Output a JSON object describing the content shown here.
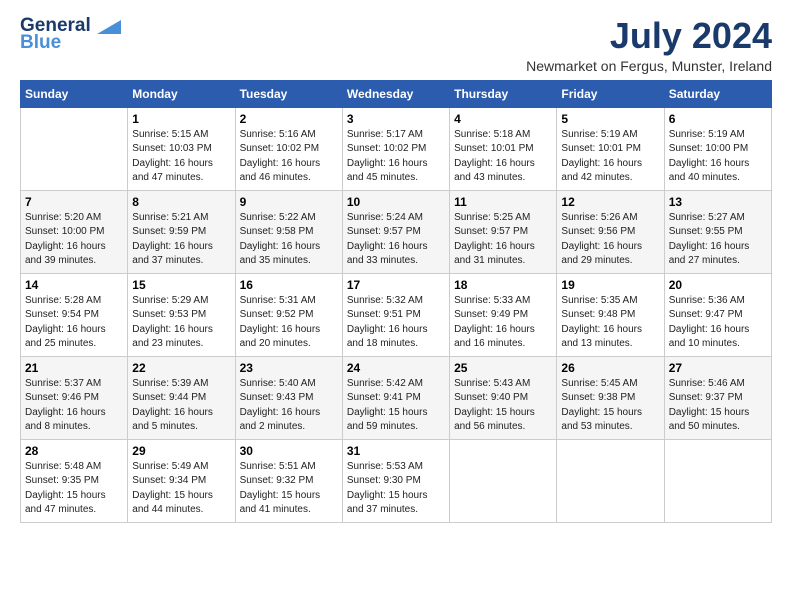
{
  "header": {
    "logo_line1": "General",
    "logo_line2": "Blue",
    "month_title": "July 2024",
    "subtitle": "Newmarket on Fergus, Munster, Ireland"
  },
  "weekdays": [
    "Sunday",
    "Monday",
    "Tuesday",
    "Wednesday",
    "Thursday",
    "Friday",
    "Saturday"
  ],
  "weeks": [
    [
      {
        "day": "",
        "info": ""
      },
      {
        "day": "1",
        "info": "Sunrise: 5:15 AM\nSunset: 10:03 PM\nDaylight: 16 hours\nand 47 minutes."
      },
      {
        "day": "2",
        "info": "Sunrise: 5:16 AM\nSunset: 10:02 PM\nDaylight: 16 hours\nand 46 minutes."
      },
      {
        "day": "3",
        "info": "Sunrise: 5:17 AM\nSunset: 10:02 PM\nDaylight: 16 hours\nand 45 minutes."
      },
      {
        "day": "4",
        "info": "Sunrise: 5:18 AM\nSunset: 10:01 PM\nDaylight: 16 hours\nand 43 minutes."
      },
      {
        "day": "5",
        "info": "Sunrise: 5:19 AM\nSunset: 10:01 PM\nDaylight: 16 hours\nand 42 minutes."
      },
      {
        "day": "6",
        "info": "Sunrise: 5:19 AM\nSunset: 10:00 PM\nDaylight: 16 hours\nand 40 minutes."
      }
    ],
    [
      {
        "day": "7",
        "info": "Sunrise: 5:20 AM\nSunset: 10:00 PM\nDaylight: 16 hours\nand 39 minutes."
      },
      {
        "day": "8",
        "info": "Sunrise: 5:21 AM\nSunset: 9:59 PM\nDaylight: 16 hours\nand 37 minutes."
      },
      {
        "day": "9",
        "info": "Sunrise: 5:22 AM\nSunset: 9:58 PM\nDaylight: 16 hours\nand 35 minutes."
      },
      {
        "day": "10",
        "info": "Sunrise: 5:24 AM\nSunset: 9:57 PM\nDaylight: 16 hours\nand 33 minutes."
      },
      {
        "day": "11",
        "info": "Sunrise: 5:25 AM\nSunset: 9:57 PM\nDaylight: 16 hours\nand 31 minutes."
      },
      {
        "day": "12",
        "info": "Sunrise: 5:26 AM\nSunset: 9:56 PM\nDaylight: 16 hours\nand 29 minutes."
      },
      {
        "day": "13",
        "info": "Sunrise: 5:27 AM\nSunset: 9:55 PM\nDaylight: 16 hours\nand 27 minutes."
      }
    ],
    [
      {
        "day": "14",
        "info": "Sunrise: 5:28 AM\nSunset: 9:54 PM\nDaylight: 16 hours\nand 25 minutes."
      },
      {
        "day": "15",
        "info": "Sunrise: 5:29 AM\nSunset: 9:53 PM\nDaylight: 16 hours\nand 23 minutes."
      },
      {
        "day": "16",
        "info": "Sunrise: 5:31 AM\nSunset: 9:52 PM\nDaylight: 16 hours\nand 20 minutes."
      },
      {
        "day": "17",
        "info": "Sunrise: 5:32 AM\nSunset: 9:51 PM\nDaylight: 16 hours\nand 18 minutes."
      },
      {
        "day": "18",
        "info": "Sunrise: 5:33 AM\nSunset: 9:49 PM\nDaylight: 16 hours\nand 16 minutes."
      },
      {
        "day": "19",
        "info": "Sunrise: 5:35 AM\nSunset: 9:48 PM\nDaylight: 16 hours\nand 13 minutes."
      },
      {
        "day": "20",
        "info": "Sunrise: 5:36 AM\nSunset: 9:47 PM\nDaylight: 16 hours\nand 10 minutes."
      }
    ],
    [
      {
        "day": "21",
        "info": "Sunrise: 5:37 AM\nSunset: 9:46 PM\nDaylight: 16 hours\nand 8 minutes."
      },
      {
        "day": "22",
        "info": "Sunrise: 5:39 AM\nSunset: 9:44 PM\nDaylight: 16 hours\nand 5 minutes."
      },
      {
        "day": "23",
        "info": "Sunrise: 5:40 AM\nSunset: 9:43 PM\nDaylight: 16 hours\nand 2 minutes."
      },
      {
        "day": "24",
        "info": "Sunrise: 5:42 AM\nSunset: 9:41 PM\nDaylight: 15 hours\nand 59 minutes."
      },
      {
        "day": "25",
        "info": "Sunrise: 5:43 AM\nSunset: 9:40 PM\nDaylight: 15 hours\nand 56 minutes."
      },
      {
        "day": "26",
        "info": "Sunrise: 5:45 AM\nSunset: 9:38 PM\nDaylight: 15 hours\nand 53 minutes."
      },
      {
        "day": "27",
        "info": "Sunrise: 5:46 AM\nSunset: 9:37 PM\nDaylight: 15 hours\nand 50 minutes."
      }
    ],
    [
      {
        "day": "28",
        "info": "Sunrise: 5:48 AM\nSunset: 9:35 PM\nDaylight: 15 hours\nand 47 minutes."
      },
      {
        "day": "29",
        "info": "Sunrise: 5:49 AM\nSunset: 9:34 PM\nDaylight: 15 hours\nand 44 minutes."
      },
      {
        "day": "30",
        "info": "Sunrise: 5:51 AM\nSunset: 9:32 PM\nDaylight: 15 hours\nand 41 minutes."
      },
      {
        "day": "31",
        "info": "Sunrise: 5:53 AM\nSunset: 9:30 PM\nDaylight: 15 hours\nand 37 minutes."
      },
      {
        "day": "",
        "info": ""
      },
      {
        "day": "",
        "info": ""
      },
      {
        "day": "",
        "info": ""
      }
    ]
  ]
}
